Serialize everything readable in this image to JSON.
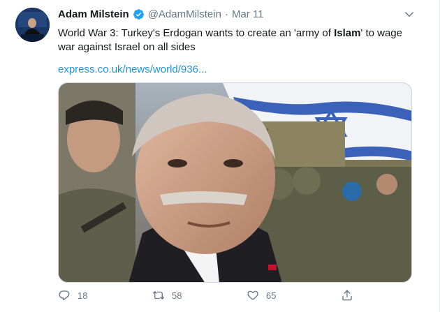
{
  "tweet": {
    "author_name": "Adam Milstein",
    "handle": "@AdamMilstein",
    "separator": "·",
    "date": "Mar 11",
    "text_line1_pre": "World War 3: Turkey's Erdogan wants to create an 'army of ",
    "text_bold": "Islam",
    "text_line1_post": "' to wage",
    "text_line2": "war against Israel on all sides",
    "link": "express.co.uk/news/world/936..."
  },
  "actions": {
    "reply_count": "18",
    "retweet_count": "58",
    "like_count": "65"
  },
  "colors": {
    "link": "#1b95e0",
    "verified": "#1da1f2",
    "muted": "#657786"
  },
  "icons": {
    "verified": "verified-badge-icon",
    "caret": "chevron-down-icon",
    "reply": "reply-icon",
    "retweet": "retweet-icon",
    "like": "heart-icon",
    "share": "share-icon"
  }
}
